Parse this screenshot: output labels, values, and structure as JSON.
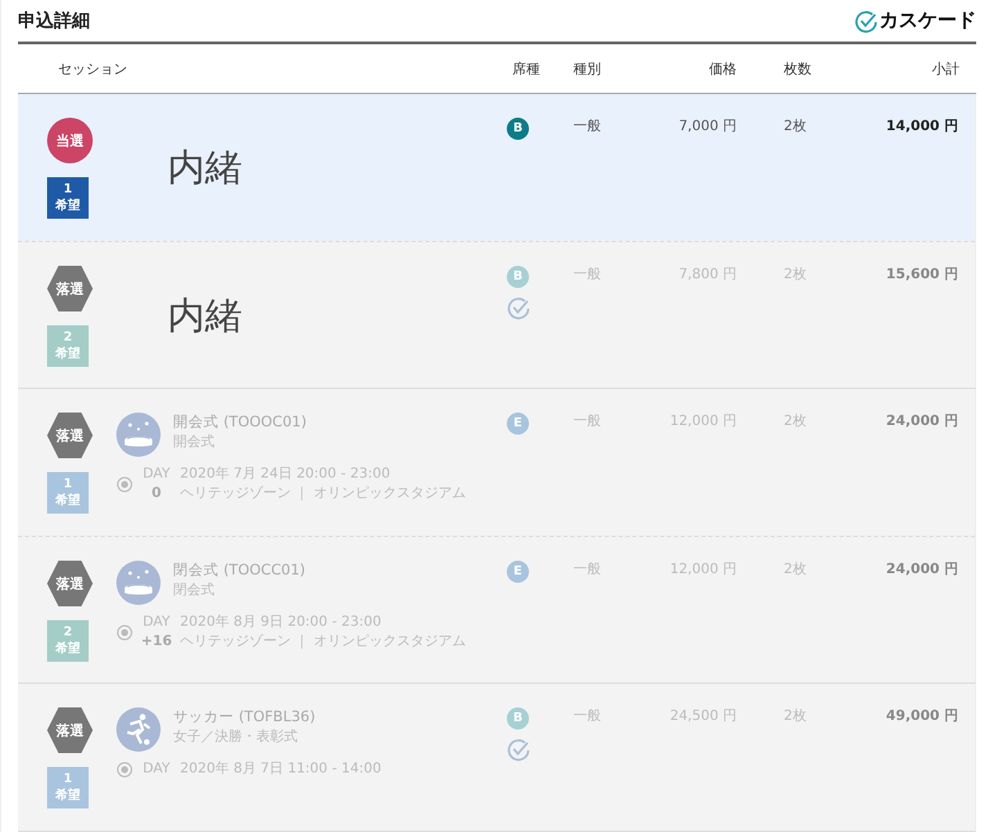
{
  "header": {
    "title": "申込詳細",
    "logo": "カスケード"
  },
  "columns": [
    {
      "label": "セッション"
    },
    {
      "label": "席種"
    },
    {
      "label": "種別"
    },
    {
      "label": "価格"
    },
    {
      "label": "枚数"
    },
    {
      "label": "小計"
    }
  ],
  "groups": [
    {
      "entries": [
        {
          "result": {
            "label": "当選",
            "kind": "won"
          },
          "rank": {
            "number": "1",
            "label": "希望",
            "color": "#1f5aa6"
          },
          "session": {
            "kind": "undisclosed",
            "text": "内緒"
          },
          "seat": {
            "letter": "B",
            "color": "#0e7c86",
            "confirmed": false
          },
          "type": "一般",
          "price": "7,000 円",
          "quantity": "2枚",
          "subtotal": "14,000 円"
        },
        {
          "result": {
            "label": "落選",
            "kind": "lost"
          },
          "rank": {
            "number": "2",
            "label": "希望",
            "color": "#a3cdc6"
          },
          "session": {
            "kind": "undisclosed",
            "text": "内緒"
          },
          "seat": {
            "letter": "B",
            "color": "#a6d0d4",
            "confirmed": true
          },
          "type": "一般",
          "price": "7,800 円",
          "quantity": "2枚",
          "subtotal": "15,600 円"
        }
      ]
    },
    {
      "entries": [
        {
          "result": {
            "label": "落選",
            "kind": "lost"
          },
          "rank": {
            "number": "1",
            "label": "希望",
            "color": "#a9c4de"
          },
          "session": {
            "kind": "ceremony",
            "title": "開会式 (TOOOC01)",
            "subtitle": "開会式",
            "day_label": "DAY",
            "day_number": "0",
            "datetime": "2020年 7月 24日 20:00 - 23:00",
            "venue": "ヘリテッジゾーン ｜ オリンピックスタジアム"
          },
          "seat": {
            "letter": "E",
            "color": "#a9c4de",
            "confirmed": false
          },
          "type": "一般",
          "price": "12,000 円",
          "quantity": "2枚",
          "subtotal": "24,000 円"
        },
        {
          "result": {
            "label": "落選",
            "kind": "lost"
          },
          "rank": {
            "number": "2",
            "label": "希望",
            "color": "#a3cdc6"
          },
          "session": {
            "kind": "ceremony",
            "title": "閉会式 (TOOCC01)",
            "subtitle": "閉会式",
            "day_label": "DAY",
            "day_number": "+16",
            "datetime": "2020年 8月 9日 20:00 - 23:00",
            "venue": "ヘリテッジゾーン ｜ オリンピックスタジアム"
          },
          "seat": {
            "letter": "E",
            "color": "#a9c4de",
            "confirmed": false
          },
          "type": "一般",
          "price": "12,000 円",
          "quantity": "2枚",
          "subtotal": "24,000 円"
        }
      ]
    },
    {
      "entries": [
        {
          "result": {
            "label": "落選",
            "kind": "lost"
          },
          "rank": {
            "number": "1",
            "label": "希望",
            "color": "#a9c4de"
          },
          "session": {
            "kind": "sport",
            "title": "サッカー (TOFBL36)",
            "subtitle": "女子／決勝・表彰式",
            "day_label": "DAY",
            "datetime": "2020年 8月 7日 11:00 - 14:00"
          },
          "seat": {
            "letter": "B",
            "color": "#a6d0d4",
            "confirmed": true
          },
          "type": "一般",
          "price": "24,500 円",
          "quantity": "2枚",
          "subtotal": "49,000 円"
        }
      ]
    }
  ]
}
